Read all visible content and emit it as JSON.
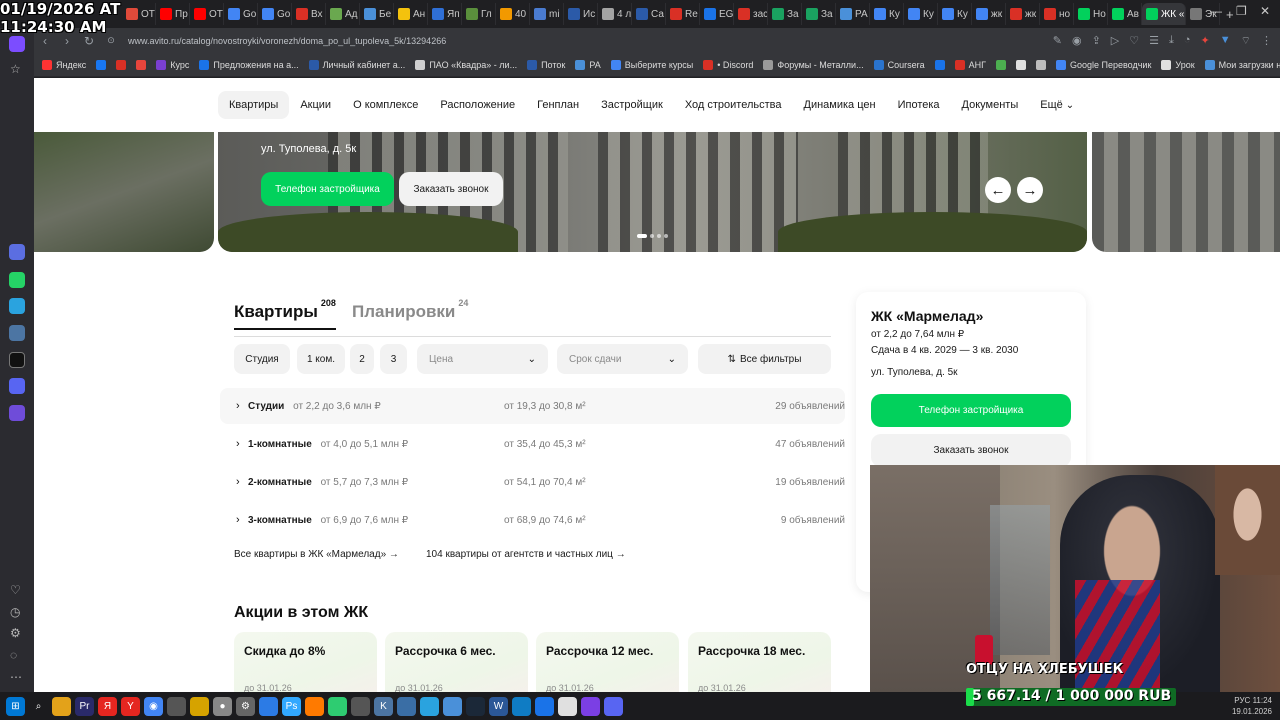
{
  "overlay": {
    "date": "01/19/2026 AT",
    "time": "11:24:30 AM"
  },
  "browser": {
    "url": "www.avito.ru/catalog/novostroyki/voronezh/doma_po_ul_tupoleva_5k/13294266",
    "tabs": [
      {
        "label": "ОТ",
        "color": "#e04a3a"
      },
      {
        "label": "Пр",
        "color": "#ff0000"
      },
      {
        "label": "ОТ",
        "color": "#ff0000"
      },
      {
        "label": "Go",
        "color": "#4285f4"
      },
      {
        "label": "Go",
        "color": "#4285f4"
      },
      {
        "label": "Вх",
        "color": "#d93025"
      },
      {
        "label": "Ад",
        "color": "#6aa84f"
      },
      {
        "label": "Бе",
        "color": "#4a90d9"
      },
      {
        "label": "Ан",
        "color": "#f4c20d"
      },
      {
        "label": "Яп",
        "color": "#2f6fd6"
      },
      {
        "label": "Гл",
        "color": "#5a8f3c"
      },
      {
        "label": "40",
        "color": "#f29900"
      },
      {
        "label": "mi",
        "color": "#4a7bd0"
      },
      {
        "label": "Ис",
        "color": "#2b5aa8"
      },
      {
        "label": "4 л",
        "color": "#a3a3a3"
      },
      {
        "label": "Са",
        "color": "#2b5aa8"
      },
      {
        "label": "Re",
        "color": "#d93025"
      },
      {
        "label": "EG",
        "color": "#1a73e8"
      },
      {
        "label": "зас",
        "color": "#d93025"
      },
      {
        "label": "За",
        "color": "#1aa260"
      },
      {
        "label": "За",
        "color": "#1aa260"
      },
      {
        "label": "РА",
        "color": "#4a90d9"
      },
      {
        "label": "Ку",
        "color": "#4285f4"
      },
      {
        "label": "Ку",
        "color": "#4285f4"
      },
      {
        "label": "Ку",
        "color": "#4285f4"
      },
      {
        "label": "жк",
        "color": "#4285f4"
      },
      {
        "label": "жк",
        "color": "#d93025"
      },
      {
        "label": "но",
        "color": "#d93025"
      },
      {
        "label": "Но",
        "color": "#02d15c"
      },
      {
        "label": "Ав",
        "color": "#02d15c"
      },
      {
        "label": "ЖК «М",
        "color": "#02d15c"
      },
      {
        "label": "Эк",
        "color": "#777777"
      }
    ],
    "bookmarks": [
      {
        "label": "Яндекс",
        "color": "#ff3333"
      },
      {
        "label": "",
        "color": "#1877f2"
      },
      {
        "label": "",
        "color": "#d93025"
      },
      {
        "label": "",
        "color": "#e8453c"
      },
      {
        "label": "Курс",
        "color": "#7a3fd1"
      },
      {
        "label": "Предложения на а...",
        "color": "#1a73e8"
      },
      {
        "label": "Личный кабинет а...",
        "color": "#2b5aa8"
      },
      {
        "label": "ПАО «Квадра» - ли...",
        "color": "#d0d0d0"
      },
      {
        "label": "Поток",
        "color": "#2b5aa8"
      },
      {
        "label": "РА",
        "color": "#4a90d9"
      },
      {
        "label": "Выберите курсы",
        "color": "#4285f4"
      },
      {
        "label": "• Discord",
        "color": "#d93025"
      },
      {
        "label": "Форумы - Металли...",
        "color": "#9a9a9a"
      },
      {
        "label": "Coursera",
        "color": "#2a73cc"
      },
      {
        "label": "",
        "color": "#1a73e8"
      },
      {
        "label": "АНГ",
        "color": "#d93025"
      },
      {
        "label": "",
        "color": "#4caf50"
      },
      {
        "label": "",
        "color": "#e0e0e0"
      },
      {
        "label": "",
        "color": "#bdbdbd"
      },
      {
        "label": "Google Переводчик",
        "color": "#4285f4"
      },
      {
        "label": "Урок",
        "color": "#e0e0e0"
      },
      {
        "label": "Мои загрузки на са...",
        "color": "#4a90d9"
      }
    ]
  },
  "site": {
    "nav": [
      "Квартиры",
      "Акции",
      "О комплексе",
      "Расположение",
      "Генплан",
      "Застройщик",
      "Ход строительства",
      "Динамика цен",
      "Ипотека",
      "Документы",
      "Ещё"
    ],
    "hero": {
      "address": "ул. Туполева, д. 5к",
      "phone_btn": "Телефон застройщика",
      "call_btn": "Заказать звонок",
      "prev": "←",
      "next": "→"
    },
    "tabs": [
      {
        "label": "Квартиры",
        "count": "208"
      },
      {
        "label": "Планировки",
        "count": "24"
      }
    ],
    "filters": {
      "chips": [
        "Студия",
        "1 ком.",
        "2",
        "3"
      ],
      "price_placeholder": "Цена",
      "deadline_placeholder": "Срок сдачи",
      "all_filters": "Все фильтры"
    },
    "rows": [
      {
        "name": "Студии",
        "price": "от 2,2 до 3,6 млн ₽",
        "area": "от 19,3 до 30,8 м²",
        "count": "29 объявлений"
      },
      {
        "name": "1-комнатные",
        "price": "от 4,0 до 5,1 млн ₽",
        "area": "от 35,4 до 45,3 м²",
        "count": "47 объявлений"
      },
      {
        "name": "2-комнатные",
        "price": "от 5,7 до 7,3 млн ₽",
        "area": "от 54,1 до 70,4 м²",
        "count": "19 объявлений"
      },
      {
        "name": "3-комнатные",
        "price": "от 6,9 до 7,6 млн ₽",
        "area": "от 68,9 до 74,6 м²",
        "count": "9 объявлений"
      }
    ],
    "links": {
      "all": "Все квартиры в ЖК «Мармелад»",
      "agents": "104 квартиры от агентств и частных лиц"
    },
    "promos_title": "Акции в этом ЖК",
    "promos": [
      {
        "title": "Скидка до 8%",
        "date": "до 31.01.26"
      },
      {
        "title": "Рассрочка 6 мес.",
        "date": "до 31.01.26"
      },
      {
        "title": "Рассрочка 12 мес.",
        "date": "до 31.01.26"
      },
      {
        "title": "Рассрочка 18 мес.",
        "date": "до 31.01.26"
      }
    ],
    "card": {
      "title": "ЖК «Мармелад»",
      "price": "от 2,2 до 7,64 млн ₽",
      "delivery": "Сдача в 4 кв. 2029 — 3 кв. 2030",
      "address": "ул. Туполева, д. 5к",
      "phone_btn": "Телефон застройщика",
      "call_btn": "Заказать звонок"
    }
  },
  "stream": {
    "caption": "ОТЦУ НА ХЛЕБУШЕК",
    "goal_text": "5 667.14 / 1 000 000 RUB",
    "goal_progress": 0.0057
  },
  "taskbar": {
    "time": "11:24",
    "date": "19.01.2026",
    "lang": "РУС"
  },
  "colors": {
    "accent_green": "#02d15c",
    "chip_bg": "#f2f2f2"
  }
}
